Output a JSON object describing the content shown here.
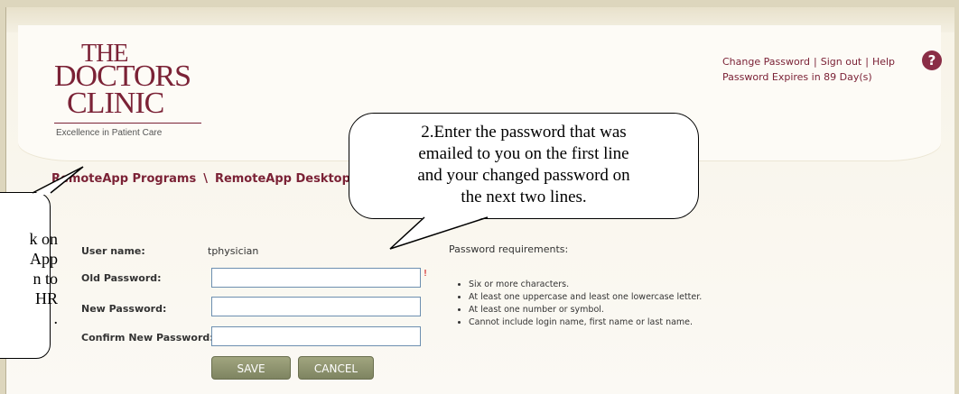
{
  "logo": {
    "line1": "THE",
    "line2": "DOCTORS",
    "line3": "CLINIC",
    "tagline": "Excellence in Patient Care"
  },
  "header_links": {
    "change_password": "Change Password",
    "sign_out": "Sign out",
    "help": "Help",
    "separator": "|",
    "help_icon_glyph": "?",
    "password_expires": "Password Expires in 89 Day(s)"
  },
  "breadcrumb": {
    "programs": "RemoteApp Programs",
    "separator": "\\",
    "desktop": "RemoteApp Desktop"
  },
  "form": {
    "username_label": "User name:",
    "username_value": "tphysician",
    "old_password_label": "Old Password:",
    "new_password_label": "New Password:",
    "confirm_password_label": "Confirm New Password:",
    "old_password_value": "",
    "new_password_value": "",
    "confirm_password_value": "",
    "required_marker": "!",
    "save_label": "SAVE",
    "cancel_label": "CANCEL"
  },
  "requirements": {
    "title": "Password requirements:",
    "items": [
      "Six or more characters.",
      "At least one uppercase and least one lowercase letter.",
      "At least one number or symbol.",
      "Cannot include login name, first name or last name."
    ]
  },
  "callouts": {
    "main": {
      "line1": "2.Enter the password that was",
      "line2": "emailed to you on the first line",
      "line3": "and your changed password on",
      "line4": "the next two lines."
    },
    "left": {
      "line1": "k on",
      "line2": "App",
      "line3": "n to",
      "line4": "HR",
      "line5": "."
    }
  },
  "colors": {
    "brand": "#7b2236",
    "button": "#8e9370",
    "field_border": "#6d8fb0",
    "help_icon": "#8a2d46"
  },
  "icons": {
    "help": "help-circle-icon"
  }
}
